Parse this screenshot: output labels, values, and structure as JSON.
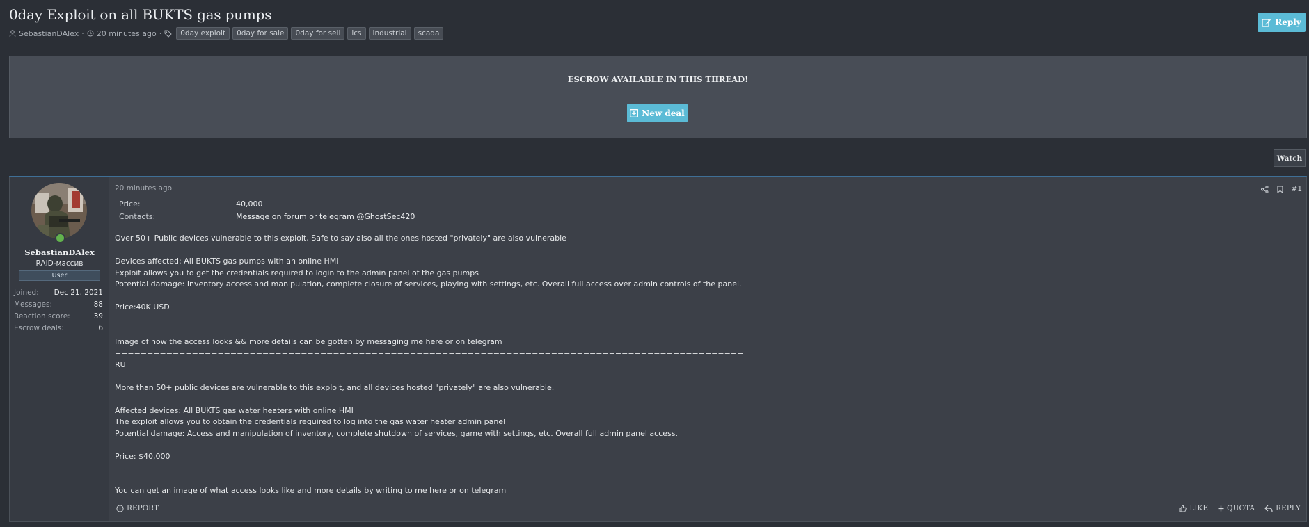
{
  "thread": {
    "title": "0day Exploit on all BUKTS gas pumps",
    "author": "SebastianDAlex",
    "time": "20 minutes ago",
    "tags": [
      "0day exploit",
      "0day for sale",
      "0day for sell",
      "ics",
      "industrial",
      "scada"
    ]
  },
  "buttons": {
    "reply_top": "Reply",
    "new_deal": "New deal",
    "watch": "Watch"
  },
  "escrow": {
    "title": "ESCROW AVAILABLE IN THIS THREAD!"
  },
  "user": {
    "name": "SebastianDAlex",
    "title": "RAID-массив",
    "badge": "User",
    "stats": [
      {
        "label": "Joined:",
        "value": "Dec 21, 2021"
      },
      {
        "label": "Messages:",
        "value": "88"
      },
      {
        "label": "Reaction score:",
        "value": "39"
      },
      {
        "label": "Escrow deals:",
        "value": "6"
      }
    ]
  },
  "post": {
    "time": "20 minutes ago",
    "number": "#1",
    "fields": [
      {
        "label": "Price:",
        "value": "40,000"
      },
      {
        "label": "Contacts:",
        "value": "Message on forum or telegram @GhostSec420"
      }
    ],
    "body": "Over 50+ Public devices vulnerable to this exploit, Safe to say also all the ones hosted \"privately\" are also vulnerable\n\nDevices affected: All BUKTS gas pumps with an online HMI\nExploit allows you to get the credentials required to login to the admin panel of the gas pumps\nPotential damage: Inventory access and manipulation, complete closure of services, playing with settings, etc. Overall full access over admin controls of the panel.\n\nPrice:40K USD\n\n\nImage of how the access looks && more details can be gotten by messaging me here or on telegram\n==================================================================================================\nRU\n\nMore than 50+ public devices are vulnerable to this exploit, and all devices hosted \"privately\" are also vulnerable.\n\nAffected devices: All BUKTS gas water heaters with online HMI\nThe exploit allows you to obtain the credentials required to log into the gas water heater admin panel\nPotential damage: Access and manipulation of inventory, complete shutdown of services, game with settings, etc. Overall full admin panel access.\n\nPrice: $40,000\n\n\nYou can get an image of what access looks like and more details by writing to me here or on telegram",
    "report": "REPORT",
    "like": "LIKE",
    "quota": "QUOTA",
    "reply": "REPLY"
  },
  "colors": {
    "accent": "#5bbbd6",
    "background": "#2b2f36",
    "panel": "#484d56"
  }
}
